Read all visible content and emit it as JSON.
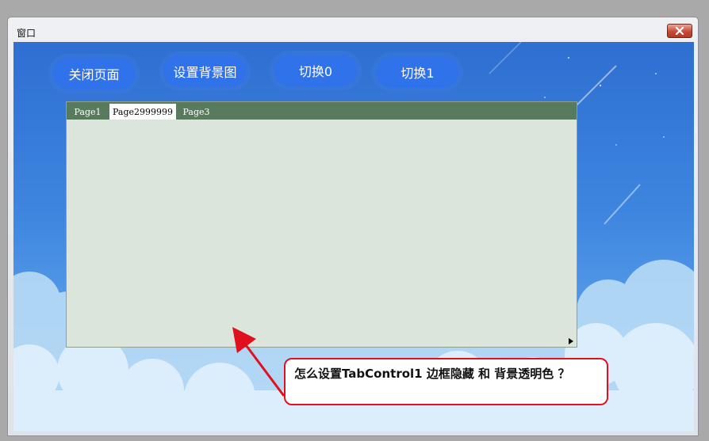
{
  "window": {
    "title": "窗口"
  },
  "toolbar": {
    "buttons": [
      {
        "label": "关闭页面"
      },
      {
        "label": "设置背景图"
      },
      {
        "label": "切换0"
      },
      {
        "label": "切换1"
      }
    ]
  },
  "tabcontrol": {
    "tabs": [
      {
        "label": "Page1",
        "active": false
      },
      {
        "label": "Page2999999",
        "active": true
      },
      {
        "label": "Page3",
        "active": false
      }
    ]
  },
  "annotation": {
    "text": "怎么设置TabControl1 边框隐藏 和 背景透明色 ？"
  },
  "colors": {
    "button": "#2f72ea",
    "tabstrip": "#587a5d",
    "tabpage": "#dce5db",
    "annotation_border": "#e0101e"
  }
}
